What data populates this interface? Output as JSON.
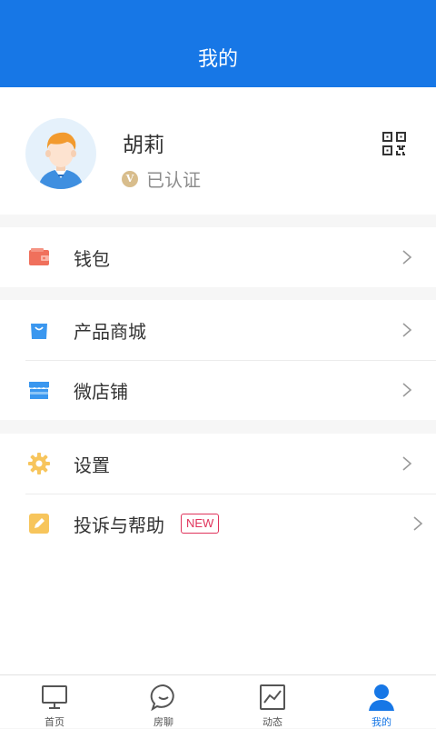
{
  "header": {
    "title": "我的"
  },
  "profile": {
    "name": "胡莉",
    "verified_badge": "V",
    "verified_text": "已认证"
  },
  "menu": {
    "wallet": "钱包",
    "mall": "产品商城",
    "shop": "微店铺",
    "settings": "设置",
    "help": "投诉与帮助",
    "new_badge": "NEW"
  },
  "tabs": [
    {
      "label": "首页",
      "icon": "monitor-icon"
    },
    {
      "label": "房聊",
      "icon": "chat-bubble-icon"
    },
    {
      "label": "动态",
      "icon": "trend-chart-icon"
    },
    {
      "label": "我的",
      "icon": "user-icon",
      "active": true
    }
  ],
  "colors": {
    "primary": "#1777e6",
    "wallet": "#f0705c",
    "mall": "#3a97ef",
    "settings": "#f7c55c",
    "new": "#e0335b"
  }
}
